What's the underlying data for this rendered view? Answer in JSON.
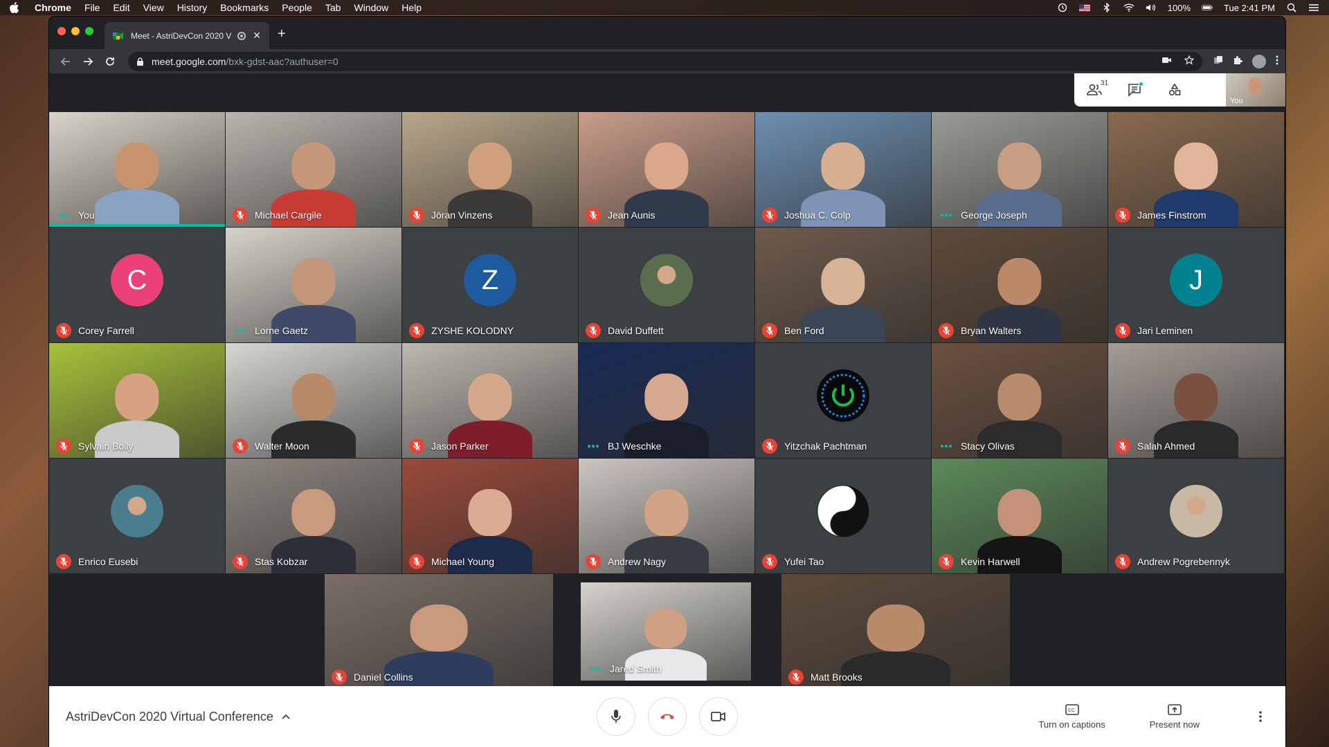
{
  "menubar": {
    "app": "Chrome",
    "items": [
      "File",
      "Edit",
      "View",
      "History",
      "Bookmarks",
      "People",
      "Tab",
      "Window",
      "Help"
    ],
    "battery": "100%",
    "clock": "Tue 2:41 PM"
  },
  "browser": {
    "tab_title": "Meet - AstriDevCon 2020 V",
    "url_host": "meet.google.com",
    "url_path": "/bxk-gdst-aac?authuser=0"
  },
  "meet": {
    "participants_count": "31",
    "self_label": "You",
    "meeting_title": "AstriDevCon 2020 Virtual Conference",
    "captions_label": "Turn on captions",
    "present_label": "Present now"
  },
  "participants": [
    {
      "name": "You",
      "status": "talking",
      "kind": "video",
      "bg": "#d9d3c8",
      "skin": "#c8946f",
      "shirt": "#8aa3c2",
      "active": true
    },
    {
      "name": "Michael Cargile",
      "status": "muted",
      "kind": "video",
      "bg": "#b9b4ad",
      "skin": "#c7977a",
      "shirt": "#c73b35"
    },
    {
      "name": "Jöran Vinzens",
      "status": "muted",
      "kind": "video",
      "bg": "#b9a78a",
      "skin": "#d0a07e",
      "shirt": "#3c3a38"
    },
    {
      "name": "Jean Aunis",
      "status": "muted",
      "kind": "video",
      "bg": "#c99d8a",
      "skin": "#d9a78a",
      "shirt": "#2f3a4d"
    },
    {
      "name": "Joshua C. Colp",
      "status": "muted",
      "kind": "video",
      "bg": "#6d8fb1",
      "skin": "#d7ae8f",
      "shirt": "#7e93b5"
    },
    {
      "name": "George Joseph",
      "status": "talking",
      "kind": "video",
      "bg": "#9a9a96",
      "skin": "#c7a084",
      "shirt": "#5b6d8e"
    },
    {
      "name": "James Finstrom",
      "status": "muted",
      "kind": "video",
      "bg": "#8a6a4e",
      "skin": "#e2b59a",
      "shirt": "#1f3a6b"
    },
    {
      "name": "Corey Farrell",
      "status": "muted",
      "kind": "letter",
      "letter": "C",
      "color": "#ec407a"
    },
    {
      "name": "Lorne Gaetz",
      "status": "talking",
      "kind": "video",
      "bg": "#d6d2c9",
      "skin": "#c59679",
      "shirt": "#3f4a6a"
    },
    {
      "name": "ZYSHE KOLODNY",
      "status": "muted",
      "kind": "letter",
      "letter": "Z",
      "color": "#1e5aa0"
    },
    {
      "name": "David Duffett",
      "status": "muted",
      "kind": "photo",
      "bg": "#5a6e4e"
    },
    {
      "name": "Ben Ford",
      "status": "muted",
      "kind": "video",
      "bg": "#6e5a4c",
      "skin": "#d9b396",
      "shirt": "#3a4656"
    },
    {
      "name": "Bryan Walters",
      "status": "muted",
      "kind": "video",
      "bg": "#5e4a3a",
      "skin": "#b9896a",
      "shirt": "#2f3544"
    },
    {
      "name": "Jari Leminen",
      "status": "muted",
      "kind": "letter",
      "letter": "J",
      "color": "#00838f"
    },
    {
      "name": "Sylvain Boily",
      "status": "muted",
      "kind": "video",
      "bg": "#a8c23a",
      "skin": "#d6a283",
      "shirt": "#c9c9c9"
    },
    {
      "name": "Walter Moon",
      "status": "muted",
      "kind": "video",
      "bg": "#d8d6d2",
      "skin": "#b98a6a",
      "shirt": "#2b2b2b"
    },
    {
      "name": "Jason Parker",
      "status": "muted",
      "kind": "video",
      "bg": "#bdb8b0",
      "skin": "#d4a88a",
      "shirt": "#7d1e2a"
    },
    {
      "name": "BJ Weschke",
      "status": "talking",
      "kind": "video",
      "bg": "#182a55",
      "skin": "#d6a98e",
      "shirt": "#1a1e2a"
    },
    {
      "name": "Yitzchak Pachtman",
      "status": "muted",
      "kind": "power"
    },
    {
      "name": "Stacy Olivas",
      "status": "talking",
      "kind": "video",
      "bg": "#6b5040",
      "skin": "#b98b6d",
      "shirt": "#2c2c2c"
    },
    {
      "name": "Salah Ahmed",
      "status": "muted",
      "kind": "video",
      "bg": "#a59c96",
      "skin": "#7a5040",
      "shirt": "#2a2a2a"
    },
    {
      "name": "Enrico Eusebi",
      "status": "muted",
      "kind": "photo",
      "bg": "#4a7e8e"
    },
    {
      "name": "Stas Kobzar",
      "status": "muted",
      "kind": "video",
      "bg": "#8d8680",
      "skin": "#c99a7e",
      "shirt": "#2c2f3a"
    },
    {
      "name": "Michael Young",
      "status": "muted",
      "kind": "video",
      "bg": "#9a4a3a",
      "skin": "#d9ab92",
      "shirt": "#1e2a4a"
    },
    {
      "name": "Andrew Nagy",
      "status": "muted",
      "kind": "video",
      "bg": "#cbc6c0",
      "skin": "#d3a385",
      "shirt": "#3a3c44"
    },
    {
      "name": "Yufei Tao",
      "status": "muted",
      "kind": "yinyang"
    },
    {
      "name": "Kevin Harwell",
      "status": "muted",
      "kind": "video",
      "bg": "#5c8a5a",
      "skin": "#c49278",
      "shirt": "#151515"
    },
    {
      "name": "Andrew Pogrebennyk",
      "status": "muted",
      "kind": "photo",
      "bg": "#c8b9a4"
    },
    {
      "name": "Daniel Collins",
      "status": "muted",
      "kind": "video",
      "bg": "#7a6e66",
      "skin": "#c99a7e",
      "shirt": "#2e3c5e"
    },
    {
      "name": "Jared Smith",
      "status": "talking",
      "kind": "video",
      "bg": "#d6d3cd",
      "skin": "#d0a084",
      "shirt": "#e8e8ea"
    },
    {
      "name": "Matt Brooks",
      "status": "muted",
      "kind": "video",
      "bg": "#5c4a3c",
      "skin": "#b98a6a",
      "shirt": "#2a2a2a"
    }
  ]
}
